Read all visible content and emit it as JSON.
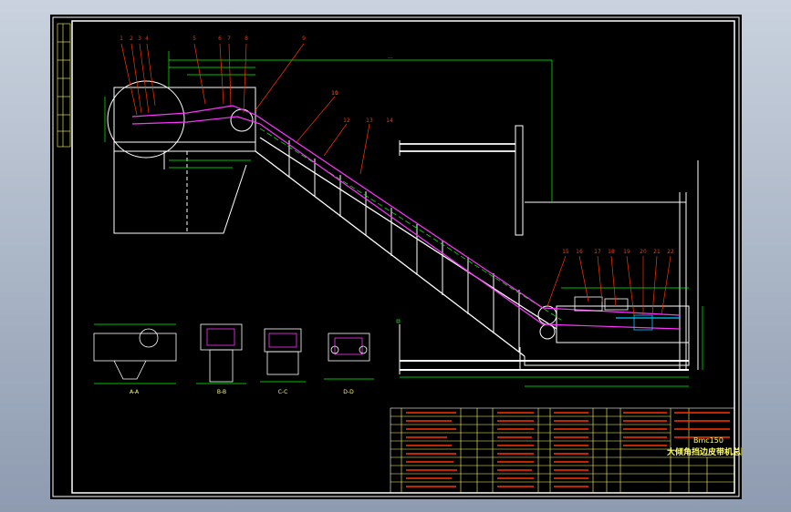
{
  "title_block": {
    "model": "Bmc150",
    "title": "大倾角挡边皮带机总图"
  },
  "callouts_top": [
    "1",
    "2",
    "3",
    "4",
    "5",
    "6",
    "7",
    "8",
    "9",
    "10"
  ],
  "callouts_mid": [
    "11",
    "12",
    "13",
    "14"
  ],
  "callouts_tail": [
    "15",
    "16",
    "17",
    "18",
    "19",
    "20",
    "21",
    "22"
  ],
  "section_labels": [
    "A-A",
    "B-B",
    "C-C",
    "D-D"
  ],
  "colors": {
    "sheet": "#000000",
    "frame": "#ffffff",
    "structure": "#ffffff",
    "dimension": "#00ff00",
    "belt": "#ff33ff",
    "leader": "#ff3300",
    "text": "#ffff66",
    "accent": "#00ccff"
  }
}
